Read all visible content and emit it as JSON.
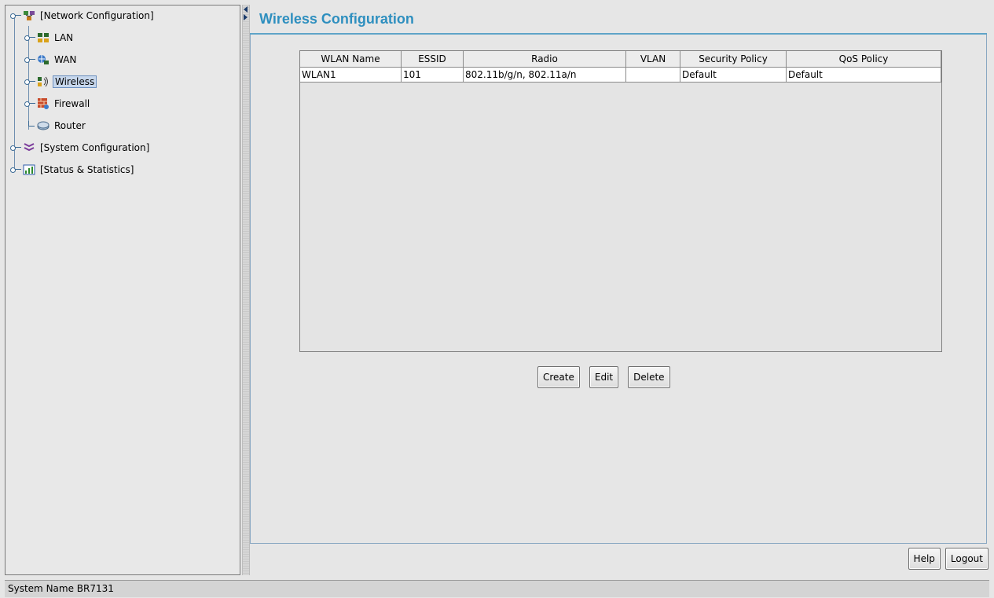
{
  "tree": {
    "items": [
      {
        "label": "[Network Configuration]",
        "icon": "network-config-icon"
      },
      {
        "label": "LAN",
        "icon": "lan-icon"
      },
      {
        "label": "WAN",
        "icon": "wan-icon"
      },
      {
        "label": "Wireless",
        "icon": "wireless-icon",
        "selected": true
      },
      {
        "label": "Firewall",
        "icon": "firewall-icon"
      },
      {
        "label": "Router",
        "icon": "router-icon"
      },
      {
        "label": "[System Configuration]",
        "icon": "system-config-icon"
      },
      {
        "label": "[Status & Statistics]",
        "icon": "status-stats-icon"
      }
    ]
  },
  "page": {
    "title": "Wireless Configuration"
  },
  "table": {
    "columns": [
      "WLAN Name",
      "ESSID",
      "Radio",
      "VLAN",
      "Security Policy",
      "QoS Policy"
    ],
    "rows": [
      [
        "WLAN1",
        "101",
        "802.11b/g/n, 802.11a/n",
        "",
        "Default",
        "Default"
      ]
    ]
  },
  "actions": {
    "create": "Create",
    "edit": "Edit",
    "delete": "Delete",
    "help": "Help",
    "logout": "Logout"
  },
  "status_bar": {
    "text": "System Name BR7131"
  },
  "colors": {
    "title": "#2e8fbf",
    "selection": "#c7d7ec"
  }
}
